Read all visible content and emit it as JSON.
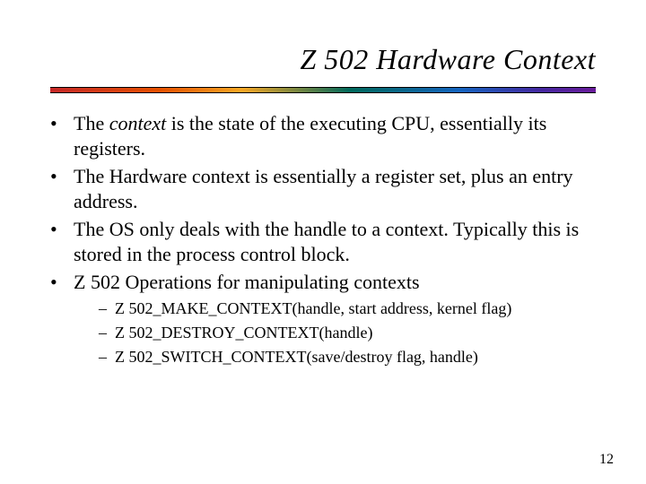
{
  "title": "Z 502 Hardware Context",
  "bullets": {
    "b1_pre": "The ",
    "b1_em": "context",
    "b1_post": " is the state of the executing CPU, essentially its registers.",
    "b2": "The Hardware context is essentially a register set, plus an entry address.",
    "b3": "The OS only deals with the handle to a context.  Typically this is stored in the process control block.",
    "b4": "Z 502 Operations for manipulating contexts"
  },
  "sub": {
    "s1": "Z 502_MAKE_CONTEXT(handle, start address, kernel flag)",
    "s2": "Z 502_DESTROY_CONTEXT(handle)",
    "s3": "Z 502_SWITCH_CONTEXT(save/destroy flag, handle)"
  },
  "page": "12"
}
